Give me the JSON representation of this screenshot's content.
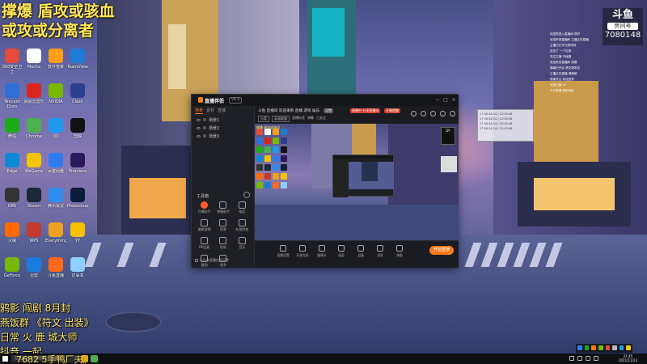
{
  "overlay": {
    "title_line1": "撑爆 盾攻或骇血",
    "title_line2": "或攻或分离者",
    "bottom_line1": "鸦影 闯剧 8月封",
    "bottom_line2": "燕饭群 《符文 出装》",
    "bottom_line3": "日常 火 鹿 城大师",
    "bottom_line4": "抖音 一起"
  },
  "taskbar_overlay_text": "7682 5手鸭厂夫》",
  "douyu": {
    "brand": "斗鱼",
    "room_label": "房间号",
    "room_number": "7080148"
  },
  "chat_lines": [
    "欢迎您进入直播间 您好",
    "欢迎来到直播间 主播正在直播",
    "主播已打开礼物特效",
    "送出了 一个礼物",
    "关注主播 不迷路",
    "欢迎来到直播间 观看",
    "弹幕已开启 请文明发言",
    "主播正在直播 请稍候",
    "感谢关注 欢迎回来",
    "送出火箭 x1",
    "今日直播 精彩继续"
  ],
  "float_box_lines": [
    "17 00:14:24 | 12:45:08",
    "17 00:14:24 | 12:45:08",
    "17 00:14:24 | 12:45:08",
    "17 00:14:24 | 12:45:08"
  ],
  "desktop_icons": [
    {
      "label": "360安全卫士",
      "color": "#e54b3c"
    },
    {
      "label": "Mocha",
      "color": "#ffffff"
    },
    {
      "label": "软件管家",
      "color": "#ff9f1a"
    },
    {
      "label": "TeamViewer",
      "color": "#1e7bd6"
    },
    {
      "label": "Tencent Docs",
      "color": "#2f6fd6"
    },
    {
      "label": "网易云音乐",
      "color": "#d9261c"
    },
    {
      "label": "NVIDIA",
      "color": "#76b900"
    },
    {
      "label": "Clash",
      "color": "#2c3f8c"
    },
    {
      "label": "微信",
      "color": "#1aad19"
    },
    {
      "label": "Chrome",
      "color": "#4caf50"
    },
    {
      "label": "QQ",
      "color": "#1e9bf0"
    },
    {
      "label": "剪映",
      "color": "#111111"
    },
    {
      "label": "Edge",
      "color": "#0b8bd6"
    },
    {
      "label": "WeGame",
      "color": "#f2c500"
    },
    {
      "label": "百度网盘",
      "color": "#2f7bf0"
    },
    {
      "label": "Premiere",
      "color": "#2a1a5e"
    },
    {
      "label": "OBS",
      "color": "#333333"
    },
    {
      "label": "Steam",
      "color": "#1b2838"
    },
    {
      "label": "腾讯会议",
      "color": "#2f8ff0"
    },
    {
      "label": "Photoshop",
      "color": "#0a1e3a"
    },
    {
      "label": "火绒",
      "color": "#ff6a00"
    },
    {
      "label": "WPS",
      "color": "#c53a2e"
    },
    {
      "label": "Everything",
      "color": "#f0a020"
    },
    {
      "label": "YY",
      "color": "#f6c200"
    },
    {
      "label": "GeForce",
      "color": "#76b900"
    },
    {
      "label": "迅雷",
      "color": "#1c7be0"
    },
    {
      "label": "斗鱼直播",
      "color": "#ff6a1a"
    },
    {
      "label": "记事本",
      "color": "#8fcfff"
    }
  ],
  "window": {
    "app_name": "直播伴侣",
    "version": "V6.0",
    "sidebar_tabs": [
      "场景",
      "素材",
      "直播"
    ],
    "scenes": [
      "场景1",
      "场景2",
      "场景3"
    ],
    "tools_title": "工具箱",
    "tools": [
      "开播助手",
      "弹幕助手",
      "抽奖",
      "美颜滤镜",
      "投票",
      "礼物特效",
      "PK连麦",
      "贴纸",
      "音乐",
      "截图",
      "更多"
    ],
    "side_footer": "公告和直播信息设置",
    "room_title": "斗鱼 直播间 欢迎来到 直播 游戏 娱乐",
    "chip_a": "设置",
    "chip_b": "直播中 分享直播间",
    "chip_c": "开播提醒",
    "row2_items": [
      "分类",
      "英雄联盟",
      "直播标签",
      "弹幕",
      "已关注"
    ],
    "pv_yellow": "撑爆 盾攻或骇血",
    "pv_chat_text": "DY",
    "controls": [
      "直播设置",
      "开麦克风",
      "摄像头",
      "画面",
      "设备",
      "消息",
      "弹幕"
    ],
    "live_button": "开始直播"
  },
  "taskbar": {
    "search_placeholder": "在这里输入你要搜索的内容",
    "time": "21:45",
    "date": "2021/11/23"
  },
  "colors": {
    "accent": "#ff7a1a",
    "overlay_yellow": "#ffe65a"
  }
}
